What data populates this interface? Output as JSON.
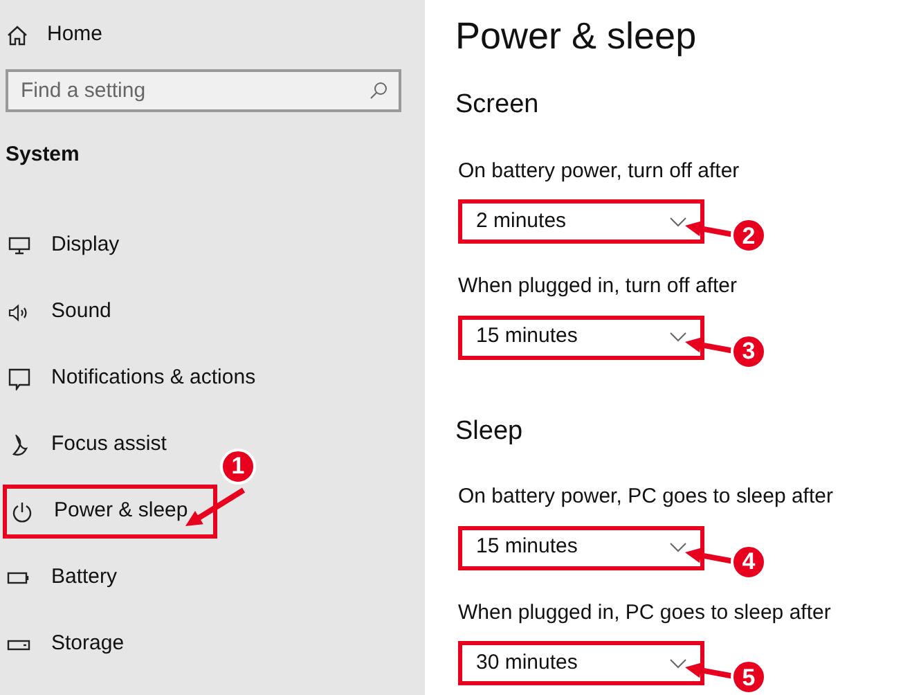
{
  "sidebar": {
    "home": "Home",
    "search": {
      "placeholder": "Find a setting"
    },
    "section": "System",
    "items": [
      {
        "label": "Display",
        "kind": "display"
      },
      {
        "label": "Sound",
        "kind": "sound"
      },
      {
        "label": "Notifications & actions",
        "kind": "notification"
      },
      {
        "label": "Focus assist",
        "kind": "moon"
      },
      {
        "label": "Power & sleep",
        "kind": "power",
        "callout": "1"
      },
      {
        "label": "Battery",
        "kind": "battery"
      },
      {
        "label": "Storage",
        "kind": "storage"
      }
    ]
  },
  "page": {
    "title": "Power & sleep",
    "sections": [
      {
        "heading": "Screen",
        "settings": [
          {
            "label": "On battery power, turn off after",
            "value": "2 minutes",
            "callout": "2"
          },
          {
            "label": "When plugged in, turn off after",
            "value": "15 minutes",
            "callout": "3"
          }
        ]
      },
      {
        "heading": "Sleep",
        "settings": [
          {
            "label": "On battery power, PC goes to sleep after",
            "value": "15 minutes",
            "callout": "4"
          },
          {
            "label": "When plugged in, PC goes to sleep after",
            "value": "30 minutes",
            "callout": "5"
          }
        ]
      }
    ]
  }
}
